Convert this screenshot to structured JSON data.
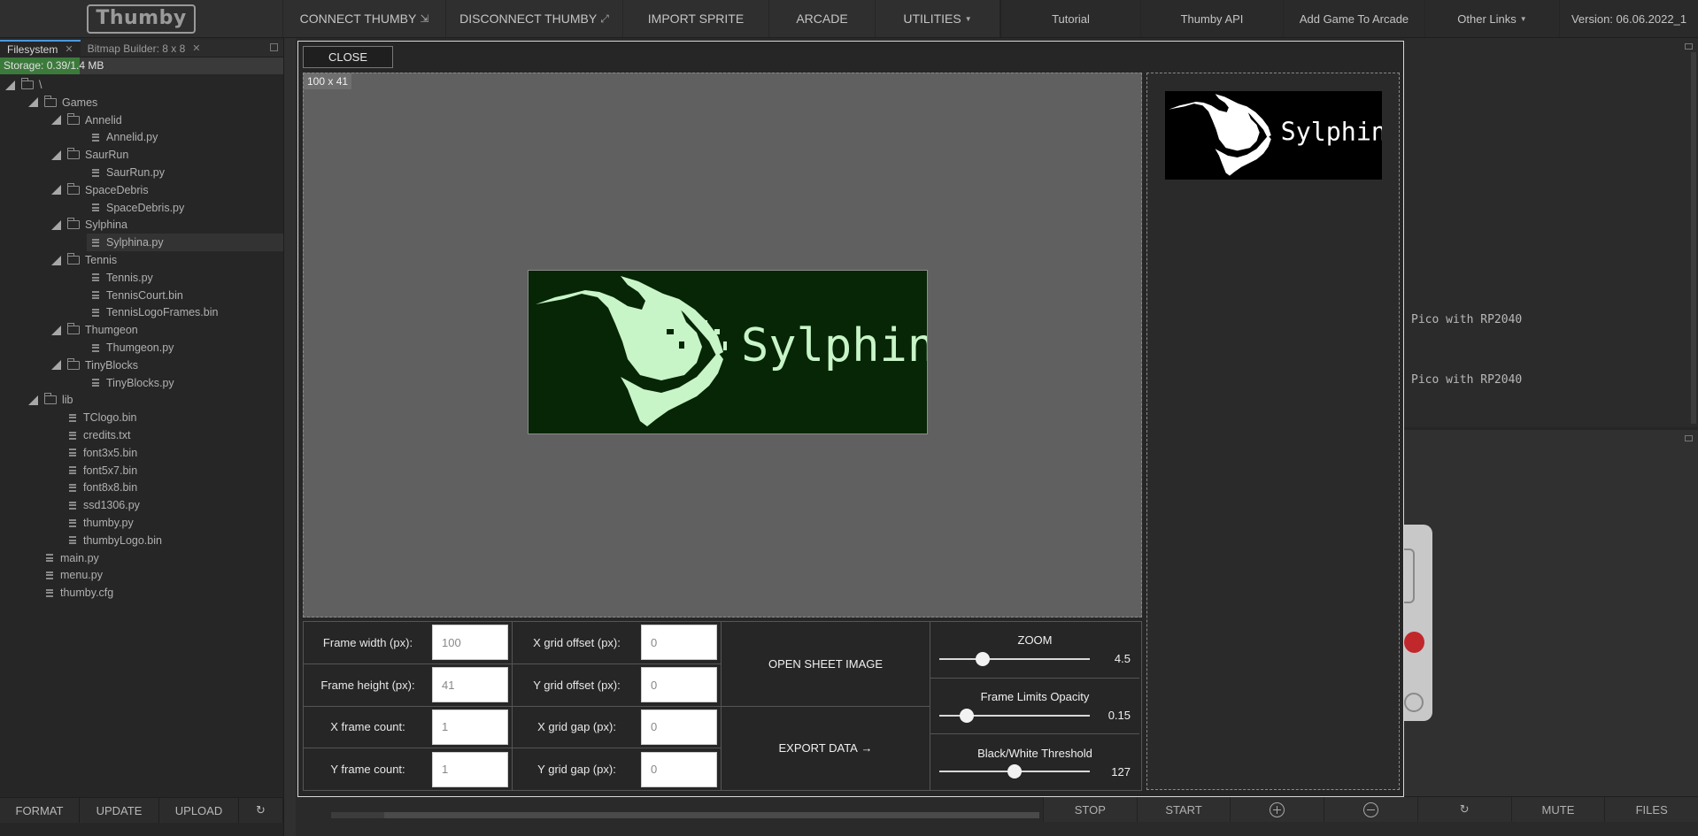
{
  "nav": {
    "logo": "Thumby",
    "connect": "CONNECT THUMBY",
    "disconnect": "DISCONNECT THUMBY",
    "import_sprite": "IMPORT SPRITE",
    "arcade": "ARCADE",
    "utilities": "UTILITIES",
    "tutorial": "Tutorial",
    "api": "Thumby API",
    "add_game": "Add Game To Arcade",
    "other_links": "Other Links",
    "version": "Version: 06.06.2022_1"
  },
  "filesystem": {
    "tabs": [
      "Filesystem",
      "Bitmap Builder: 8 x 8"
    ],
    "storage": "Storage: 0.39/1.4 MB",
    "storage_fraction": 0.28,
    "tree": [
      {
        "label": "\\",
        "type": "folder",
        "depth": 0
      },
      {
        "label": "Games",
        "type": "folder",
        "depth": 1
      },
      {
        "label": "Annelid",
        "type": "folder",
        "depth": 2
      },
      {
        "label": "Annelid.py",
        "type": "file",
        "depth": 3
      },
      {
        "label": "SaurRun",
        "type": "folder",
        "depth": 2
      },
      {
        "label": "SaurRun.py",
        "type": "file",
        "depth": 3
      },
      {
        "label": "SpaceDebris",
        "type": "folder",
        "depth": 2
      },
      {
        "label": "SpaceDebris.py",
        "type": "file",
        "depth": 3
      },
      {
        "label": "Sylphina",
        "type": "folder",
        "depth": 2
      },
      {
        "label": "Sylphina.py",
        "type": "file",
        "depth": 3,
        "selected": true
      },
      {
        "label": "Tennis",
        "type": "folder",
        "depth": 2
      },
      {
        "label": "Tennis.py",
        "type": "file",
        "depth": 3
      },
      {
        "label": "TennisCourt.bin",
        "type": "file",
        "depth": 3
      },
      {
        "label": "TennisLogoFrames.bin",
        "type": "file",
        "depth": 3
      },
      {
        "label": "Thumgeon",
        "type": "folder",
        "depth": 2
      },
      {
        "label": "Thumgeon.py",
        "type": "file",
        "depth": 3
      },
      {
        "label": "TinyBlocks",
        "type": "folder",
        "depth": 2
      },
      {
        "label": "TinyBlocks.py",
        "type": "file",
        "depth": 3
      },
      {
        "label": "lib",
        "type": "folder",
        "depth": 1
      },
      {
        "label": "TClogo.bin",
        "type": "file",
        "depth": 2
      },
      {
        "label": "credits.txt",
        "type": "file",
        "depth": 2
      },
      {
        "label": "font3x5.bin",
        "type": "file",
        "depth": 2
      },
      {
        "label": "font5x7.bin",
        "type": "file",
        "depth": 2
      },
      {
        "label": "font8x8.bin",
        "type": "file",
        "depth": 2
      },
      {
        "label": "ssd1306.py",
        "type": "file",
        "depth": 2
      },
      {
        "label": "thumby.py",
        "type": "file",
        "depth": 2
      },
      {
        "label": "thumbyLogo.bin",
        "type": "file",
        "depth": 2
      },
      {
        "label": "main.py",
        "type": "file",
        "depth": 1
      },
      {
        "label": "menu.py",
        "type": "file",
        "depth": 1
      },
      {
        "label": "thumby.cfg",
        "type": "file",
        "depth": 1
      }
    ],
    "buttons": [
      "FORMAT",
      "UPDATE",
      "UPLOAD"
    ]
  },
  "terminal": {
    "lines": [
      "Pico with RP2040",
      "Pico with RP2040"
    ]
  },
  "emulator_bar": {
    "stop": "STOP",
    "start": "START",
    "mute": "MUTE",
    "files": "FILES"
  },
  "importer": {
    "close": "CLOSE",
    "dimensions": "100 x 41",
    "sprite_text": "Sylphina",
    "fields": [
      {
        "label": "Frame width (px):",
        "value": "100"
      },
      {
        "label": "Frame height (px):",
        "value": "41"
      },
      {
        "label": "X frame count:",
        "value": "1"
      },
      {
        "label": "Y frame count:",
        "value": "1"
      }
    ],
    "offsets": [
      {
        "label": "X grid offset (px):",
        "value": "0"
      },
      {
        "label": "Y grid offset (px):",
        "value": "0"
      },
      {
        "label": "X grid gap (px):",
        "value": "0"
      },
      {
        "label": "Y grid gap (px):",
        "value": "0"
      }
    ],
    "open_sheet": "OPEN SHEET IMAGE",
    "export": "EXPORT DATA",
    "sliders": [
      {
        "title": "ZOOM",
        "value": "4.5",
        "fraction": 0.29
      },
      {
        "title": "Frame Limits Opacity",
        "value": "0.15",
        "fraction": 0.18
      },
      {
        "title": "Black/White Threshold",
        "value": "127",
        "fraction": 0.5
      }
    ]
  },
  "colors": {
    "sprite_bg": "#062606",
    "sprite_fg": "#c8f5c8",
    "preview_bg": "#000000",
    "preview_fg": "#ffffff",
    "storage_fill": "#3c7a3c",
    "accent_tab": "#4a9ae0"
  }
}
